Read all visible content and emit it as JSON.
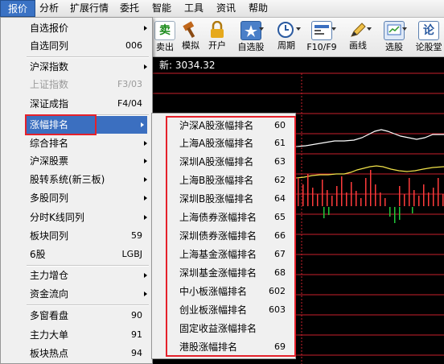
{
  "menubar": {
    "items": [
      {
        "label": "报价",
        "active": true
      },
      {
        "label": "分析"
      },
      {
        "label": "扩展行情"
      },
      {
        "label": "委托"
      },
      {
        "label": "智能"
      },
      {
        "label": "工具"
      },
      {
        "label": "资讯"
      },
      {
        "label": "帮助"
      }
    ]
  },
  "toolbar": {
    "buttons": [
      {
        "label": "卖出",
        "glyph": "卖",
        "icon": "sell-icon"
      },
      {
        "label": "模拟",
        "icon": "hammer-icon"
      },
      {
        "label": "开户",
        "icon": "lock-icon"
      },
      {
        "label": "自选股",
        "icon": "star-folder-icon"
      },
      {
        "label": "周期",
        "icon": "clock-icon"
      },
      {
        "label": "F10/F9",
        "icon": "f10-panel-icon"
      },
      {
        "label": "画线",
        "icon": "pencil-icon"
      },
      {
        "label": "选股",
        "icon": "stock-picker-icon"
      },
      {
        "label": "论股堂",
        "glyph": "论",
        "icon": "forum-icon"
      }
    ]
  },
  "chart": {
    "title": "新: 3034.32",
    "colors": {
      "grid": "#c8202c",
      "line_white": "#ffffff",
      "line_yellow": "#f2e34a",
      "bar_red": "#ff3b3b",
      "bar_green": "#22c83a"
    }
  },
  "main_menu": {
    "items": [
      {
        "label": "自选报价",
        "submenu": true
      },
      {
        "label": "自选同列",
        "shortcut": "006"
      },
      {
        "label": "沪深指数",
        "submenu": true
      },
      {
        "label": "上证指数",
        "shortcut": "F3/03",
        "disabled": true
      },
      {
        "label": "深证成指",
        "shortcut": "F4/04"
      },
      {
        "label": "涨幅排名",
        "submenu": true,
        "selected": true
      },
      {
        "label": "综合排名",
        "submenu": true
      },
      {
        "label": "沪深股票",
        "submenu": true
      },
      {
        "label": "股转系统(新三板)",
        "submenu": true
      },
      {
        "label": "多股同列",
        "submenu": true
      },
      {
        "label": "分时K线同列",
        "submenu": true
      },
      {
        "label": "板块同列",
        "shortcut": "59"
      },
      {
        "label": "6股",
        "shortcut": "LGBJ"
      },
      {
        "label": "主力增仓",
        "submenu": true
      },
      {
        "label": "资金流向",
        "submenu": true
      },
      {
        "label": "多窗看盘",
        "shortcut": "90"
      },
      {
        "label": "主力大单",
        "shortcut": "91"
      },
      {
        "label": "板块热点",
        "shortcut": "94"
      }
    ]
  },
  "sub_menu": {
    "items": [
      {
        "label": "沪深A股涨幅排名",
        "shortcut": "60"
      },
      {
        "label": "上海A股涨幅排名",
        "shortcut": "61"
      },
      {
        "label": "深圳A股涨幅排名",
        "shortcut": "63"
      },
      {
        "label": "上海B股涨幅排名",
        "shortcut": "62"
      },
      {
        "label": "深圳B股涨幅排名",
        "shortcut": "64"
      },
      {
        "label": "上海债券涨幅排名",
        "shortcut": "65"
      },
      {
        "label": "深圳债券涨幅排名",
        "shortcut": "66"
      },
      {
        "label": "上海基金涨幅排名",
        "shortcut": "67"
      },
      {
        "label": "深圳基金涨幅排名",
        "shortcut": "68"
      },
      {
        "label": "中小板涨幅排名",
        "shortcut": "602"
      },
      {
        "label": "创业板涨幅排名",
        "shortcut": "603"
      },
      {
        "label": "固定收益涨幅排名",
        "shortcut": ""
      },
      {
        "label": "港股涨幅排名",
        "shortcut": "69"
      }
    ]
  }
}
